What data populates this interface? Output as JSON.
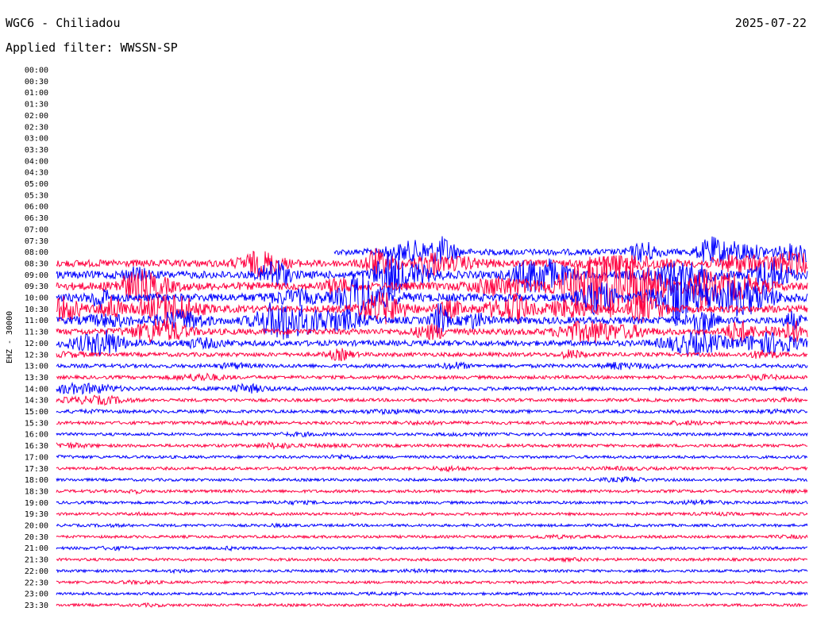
{
  "header": {
    "station_title": "WGC6 - Chiliadou",
    "date": "2025-07-22",
    "filter": "Applied filter: WWSSN-SP"
  },
  "chart_data": {
    "type": "helicorder",
    "title": "WGC6 - Chiliadou",
    "ylabel": "EHZ - 30000",
    "row_labels": [
      "00:00",
      "00:30",
      "01:00",
      "01:30",
      "02:00",
      "02:30",
      "03:00",
      "03:30",
      "04:00",
      "04:30",
      "05:00",
      "05:30",
      "06:00",
      "06:30",
      "07:00",
      "07:30",
      "08:00",
      "08:30",
      "09:00",
      "09:30",
      "10:00",
      "10:30",
      "11:00",
      "11:30",
      "12:00",
      "12:30",
      "13:00",
      "13:30",
      "14:00",
      "14:30",
      "15:00",
      "15:30",
      "16:00",
      "16:30",
      "17:00",
      "17:30",
      "18:00",
      "18:30",
      "19:00",
      "19:30",
      "20:00",
      "20:30",
      "21:00",
      "21:30",
      "22:00",
      "22:30",
      "23:00",
      "23:30"
    ],
    "colors": [
      "#0000ff",
      "#ff0040"
    ],
    "first_row_with_data": "08:00",
    "row_8_data_starts_at_fraction": 0.37,
    "activity_level": {
      "08:00": 0.55,
      "08:30": 0.7,
      "09:00": 0.75,
      "09:30": 0.8,
      "10:00": 0.85,
      "10:30": 0.7,
      "11:00": 0.7,
      "11:30": 0.55,
      "12:00": 0.45,
      "12:30": 0.25,
      "13:00": 0.2,
      "13:30": 0.15,
      "14:00": 0.2,
      "14:30": 0.12,
      "15:00": 0.12,
      "15:30": 0.12,
      "16:00": 0.08,
      "16:30": 0.1,
      "17:00": 0.07,
      "17:30": 0.08,
      "18:00": 0.06,
      "18:30": 0.08,
      "19:00": 0.07,
      "19:30": 0.06,
      "20:00": 0.05,
      "20:30": 0.05,
      "21:00": 0.06,
      "21:30": 0.06,
      "22:00": 0.05,
      "22:30": 0.05,
      "23:00": 0.05,
      "23:30": 0.05
    }
  }
}
